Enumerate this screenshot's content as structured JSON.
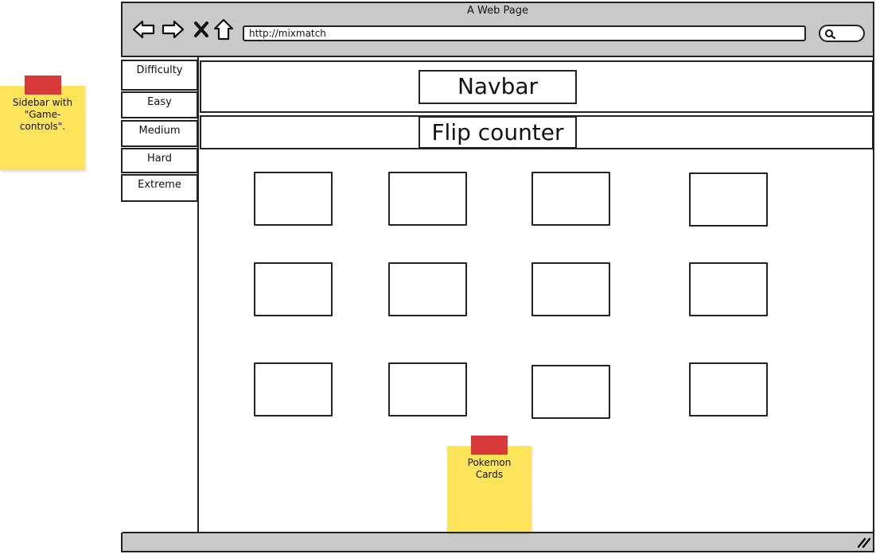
{
  "window": {
    "title": "A Web Page",
    "url": "http://mixmatch"
  },
  "icons": {
    "back": "arrow-left-icon",
    "forward": "arrow-right-icon",
    "close": "x-icon",
    "home": "home-icon",
    "search": "magnifier-icon",
    "resize": "resize-grip-icon"
  },
  "sidebar": {
    "items": [
      {
        "label": "Difficulty"
      },
      {
        "label": "Easy"
      },
      {
        "label": "Medium"
      },
      {
        "label": "Hard"
      },
      {
        "label": "Extreme"
      }
    ]
  },
  "main": {
    "navbar_label": "Navbar",
    "flip_counter_label": "Flip counter",
    "cards": [
      {
        "row": 1,
        "col": 1
      },
      {
        "row": 1,
        "col": 2
      },
      {
        "row": 1,
        "col": 3
      },
      {
        "row": 1,
        "col": 4
      },
      {
        "row": 2,
        "col": 1
      },
      {
        "row": 2,
        "col": 2
      },
      {
        "row": 2,
        "col": 3
      },
      {
        "row": 2,
        "col": 4
      },
      {
        "row": 3,
        "col": 1
      },
      {
        "row": 3,
        "col": 2
      },
      {
        "row": 3,
        "col": 3
      },
      {
        "row": 3,
        "col": 4
      }
    ]
  },
  "notes": {
    "sidebar_note": "Sidebar with \"Game-controls\".",
    "cards_note": "Pokemon Cards"
  },
  "colors": {
    "frame_gray": "#c9c9c9",
    "sticky_yellow": "#fde45a",
    "tape_red": "#d83a3a",
    "line": "#222222"
  }
}
